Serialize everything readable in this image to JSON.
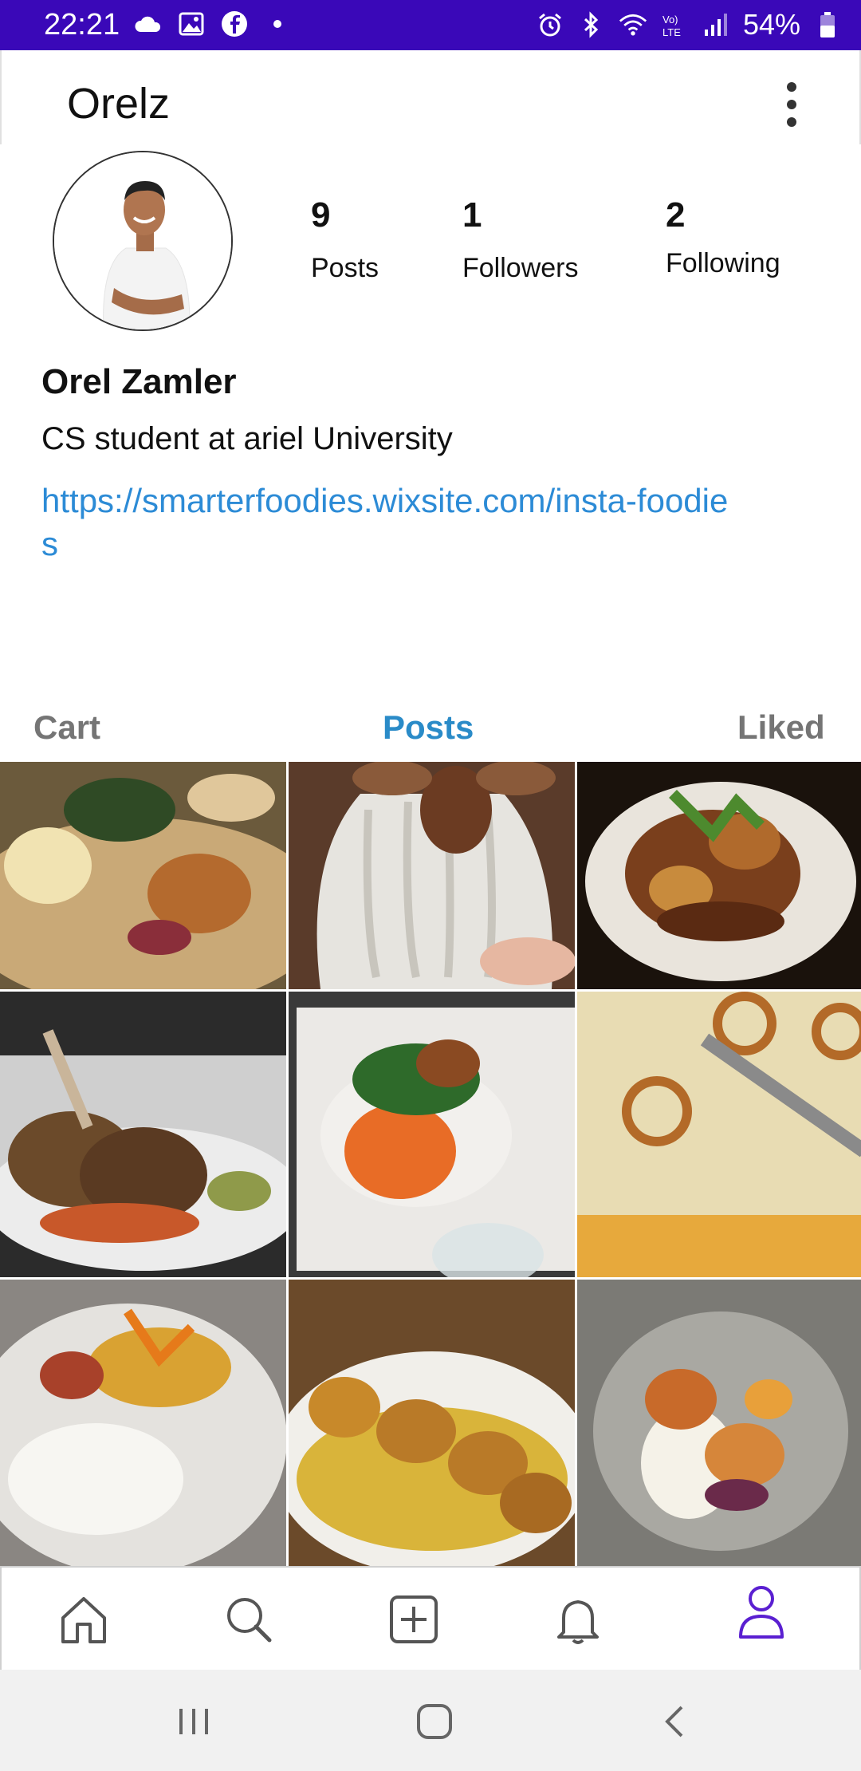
{
  "status_bar": {
    "time": "22:21",
    "battery": "54%",
    "left_icons": [
      "cloud-icon",
      "image-icon",
      "facebook-icon",
      "dot-icon"
    ],
    "right_icons": [
      "alarm-icon",
      "bluetooth-icon",
      "wifi-icon",
      "volte-icon",
      "signal-icon",
      "battery-icon"
    ],
    "background": "#3a08b8"
  },
  "app_bar": {
    "title": "Orelz",
    "menu_icon": "more-vert-icon"
  },
  "profile": {
    "posts_count": "9",
    "posts_label": "Posts",
    "followers_count": "1",
    "followers_label": "Followers",
    "following_count": "2",
    "following_label": "Following",
    "name": "Orel Zamler",
    "bio": "CS student at ariel University",
    "link": "https://smarterfoodies.wixsite.com/insta-foodies"
  },
  "tabs": [
    {
      "label": "Cart",
      "active": false
    },
    {
      "label": "Posts",
      "active": true
    },
    {
      "label": "Liked",
      "active": false
    }
  ],
  "posts": [
    {
      "alt": "scallops with vegetables"
    },
    {
      "alt": "white chocolate dessert"
    },
    {
      "alt": "plated meat dish"
    },
    {
      "alt": "lamb chops"
    },
    {
      "alt": "puree with meat"
    },
    {
      "alt": "pretzel cake"
    },
    {
      "alt": "rice with fish"
    },
    {
      "alt": "seared scallops"
    },
    {
      "alt": "scallops with sauce"
    }
  ],
  "bottom_nav": [
    "home-icon",
    "search-icon",
    "add-post-icon",
    "notifications-icon",
    "profile-icon"
  ],
  "colors": {
    "accent": "#5a1fd1",
    "link": "#2c8bd6",
    "tab_active": "#2a8bc8"
  }
}
